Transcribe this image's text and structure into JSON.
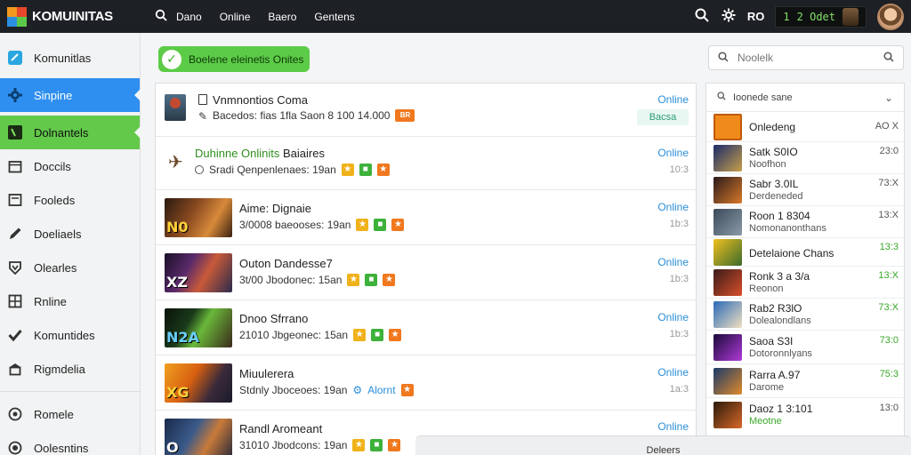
{
  "app": {
    "logo_text": "KOMUINITAS"
  },
  "topbar": {
    "nav": [
      "Dano",
      "Online",
      "Baero",
      "Gentens"
    ],
    "region": "RO",
    "credits": {
      "value": "1",
      "label": "2 Odet"
    }
  },
  "sidebar": {
    "items": [
      {
        "label": "Komunitlas",
        "icon": "app-square-icon"
      },
      {
        "label": "Sinpine",
        "icon": "gear-icon"
      },
      {
        "label": "Dolnantels",
        "icon": "terminal-icon"
      },
      {
        "label": "Doccils",
        "icon": "calendar-icon"
      },
      {
        "label": "Fooleds",
        "icon": "card-icon"
      },
      {
        "label": "Doeliaels",
        "icon": "pencil-icon"
      },
      {
        "label": "Olearles",
        "icon": "shield-icon"
      },
      {
        "label": "Rnline",
        "icon": "grid-icon"
      },
      {
        "label": "Komuntides",
        "icon": "check-icon"
      },
      {
        "label": "Rigmdelia",
        "icon": "bank-icon"
      },
      {
        "label": "Romele",
        "icon": "play-icon"
      },
      {
        "label": "Oolesntins",
        "icon": "power-icon"
      }
    ]
  },
  "status_pill": {
    "label": "Boelene eleinetis Onites"
  },
  "rows": [
    {
      "title": "Vnmnontios Coma",
      "title_hl": "",
      "sub": "Bacedos: fias 1fla Saon 8 100 14.000",
      "tag": "",
      "status": "Online",
      "count": "",
      "chip": "Bacsa",
      "badges": [],
      "sub_badge": "BR"
    },
    {
      "title": "Baiaires",
      "title_hl": "Duhinne Onlinits",
      "sub": "Sradi Qenpenlenaes: 19an",
      "tag": "",
      "status": "Online",
      "count": "10:3",
      "chip": "",
      "badges": [
        "yel",
        "grn",
        "org"
      ],
      "sub_badge": ""
    },
    {
      "title": "Aime: Dignaie",
      "title_hl": "",
      "sub": "3/0008 baeooses: 19an",
      "tag": "N0",
      "status": "Online",
      "count": "1b:3",
      "chip": "",
      "badges": [
        "yel",
        "grn",
        "org"
      ],
      "sub_badge": ""
    },
    {
      "title": "Outon Dandesse7",
      "title_hl": "",
      "sub": "3t/00 Jbodonec: 15an",
      "tag": "XZ",
      "status": "Online",
      "count": "1b:3",
      "chip": "",
      "badges": [
        "yel",
        "grn",
        "org"
      ],
      "sub_badge": ""
    },
    {
      "title": "Dnoo Sfrrano",
      "title_hl": "",
      "sub": "21010 Jbgeonec: 15an",
      "tag": "N2A",
      "status": "Online",
      "count": "1b:3",
      "chip": "",
      "badges": [
        "yel",
        "grn",
        "org"
      ],
      "sub_badge": ""
    },
    {
      "title": "Miuulerera",
      "title_hl": "",
      "sub": "Stdnly Jboceoes: 19an",
      "tag": "XG",
      "status": "Online",
      "count": "1a:3",
      "chip": "",
      "badges": [],
      "sub_badge": "Alornt"
    },
    {
      "title": "Randl Aromeant",
      "title_hl": "",
      "sub": "31010 Jbodcons: 19an",
      "tag": "O",
      "status": "Online",
      "count": "",
      "chip": "",
      "badges": [
        "yel",
        "grn",
        "org"
      ],
      "sub_badge": ""
    }
  ],
  "search": {
    "placeholder": "Noolelk"
  },
  "ranking": {
    "header": "Ioonede sane",
    "rows": [
      {
        "name": "Onledeng",
        "sub": "",
        "value": "AO X"
      },
      {
        "name": "Satk S0IO",
        "sub": "Noofhon",
        "value": "23:0"
      },
      {
        "name": "Sabr 3.0IL",
        "sub": "Derdeneded",
        "value": "73:X"
      },
      {
        "name": "Roon 1 8304",
        "sub": "Nomonanonthans",
        "value": "13:X"
      },
      {
        "name": "Detelaione Chans",
        "sub": "",
        "value": "13:3"
      },
      {
        "name": "Ronk 3 a 3/a",
        "sub": "Reonon",
        "value": "13:X"
      },
      {
        "name": "Rab2 R3lO",
        "sub": "Dolealondlans",
        "value": "73:X"
      },
      {
        "name": "Saoa S3I",
        "sub": "Dotoronnlyans",
        "value": "73:0"
      },
      {
        "name": "Rarra A.97",
        "sub": "Darome",
        "value": "75:3"
      },
      {
        "name": "Daoz 1 3:101",
        "sub": "Meotne",
        "value": "13:0"
      }
    ]
  },
  "footer": {
    "label": "Deleers"
  }
}
